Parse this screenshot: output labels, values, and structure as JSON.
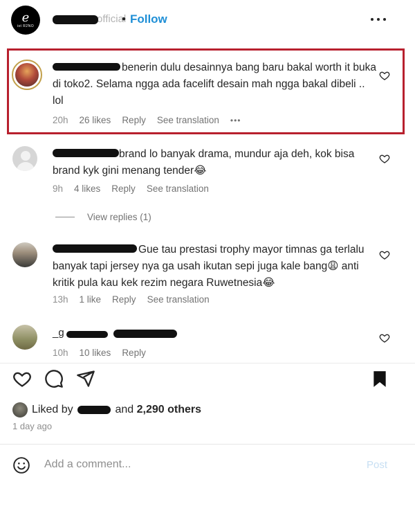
{
  "header": {
    "logo_text": "e",
    "logo_subtext": "ist R2NO",
    "username_suffix": "official",
    "follow_label": "Follow",
    "separator": "•",
    "more_icon": "more-horizontal-icon"
  },
  "comments": [
    {
      "text": "benerin dulu desainnya bang baru bakal worth it buka di toko2. Selama ngga ada facelift desain mah ngga bakal dibeli .. lol",
      "time": "20h",
      "likes": "26 likes",
      "reply": "Reply",
      "translate": "See translation",
      "more": "•••"
    },
    {
      "text": "brand lo banyak drama, mundur aja deh, kok bisa brand kyk gini menang tender😂",
      "time": "9h",
      "likes": "4 likes",
      "reply": "Reply",
      "translate": "See translation"
    },
    {
      "text": "Gue tau prestasi trophy mayor timnas ga terlalu banyak tapi jersey nya ga usah ikutan sepi juga kale bang😩 anti kritik pula kau kek rezim negara Ruwetnesia😂",
      "time": "13h",
      "likes": "1 like",
      "reply": "Reply",
      "translate": "See translation"
    },
    {
      "handle_prefix": "_g",
      "time": "10h",
      "likes": "10 likes",
      "reply": "Reply"
    }
  ],
  "view_replies": "View replies (1)",
  "footer": {
    "liked_by_prefix": "Liked by",
    "liked_by_suffix": "and",
    "others": "2,290 others",
    "ago": "1 day ago",
    "add_comment_placeholder": "Add a comment...",
    "post_label": "Post"
  },
  "colors": {
    "follow": "#1f8fd6",
    "highlight": "#b8202e",
    "muted": "#8e8e8e"
  }
}
